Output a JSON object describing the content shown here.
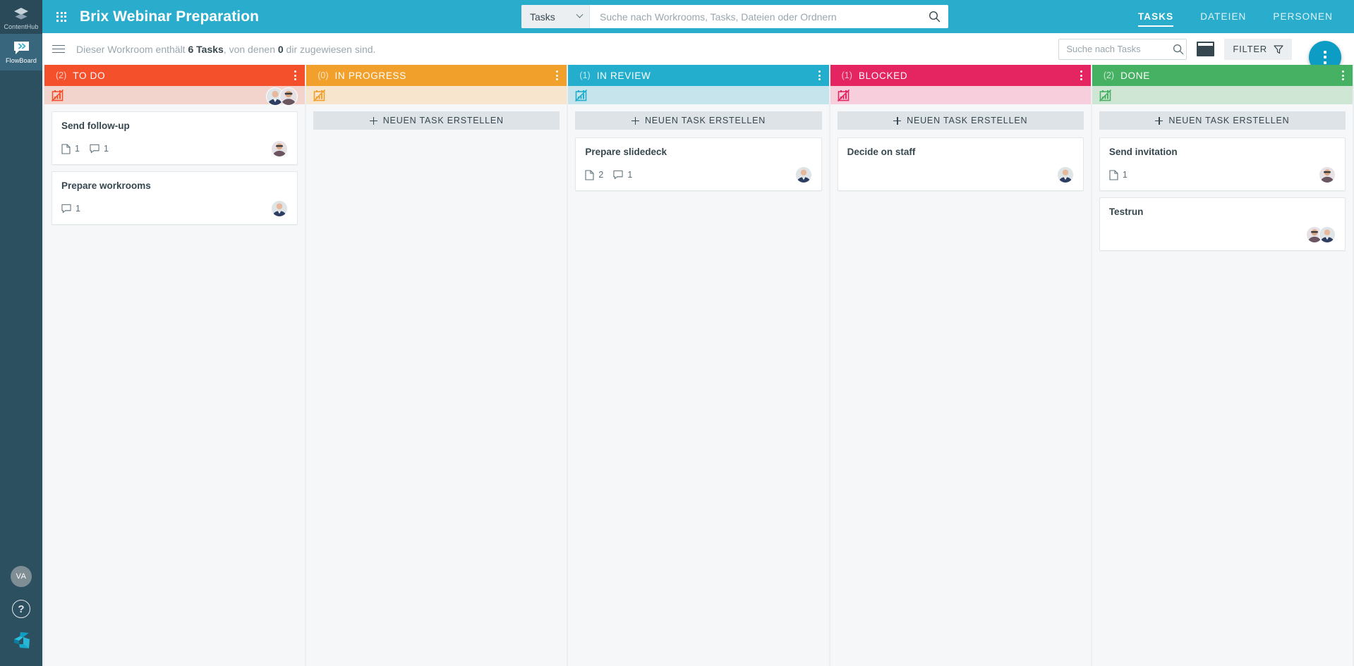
{
  "rail": {
    "items": [
      {
        "label": "ContentHub",
        "icon": "layers-icon",
        "active": false
      },
      {
        "label": "FlowBoard",
        "icon": "flowboard-icon",
        "active": true
      }
    ],
    "user_initials": "VA",
    "help_label": "?",
    "logo_name": "censhare-logo"
  },
  "topbar": {
    "app_title": "Brix Webinar Preparation",
    "grid_icon": "app-grid-icon",
    "search": {
      "scope_value": "Tasks",
      "placeholder": "Suche nach Workrooms, Tasks, Dateien oder Ordnern",
      "value": "",
      "search_icon": "search-icon",
      "chevron_icon": "chevron-down-icon"
    },
    "tabs": [
      {
        "label": "TASKS",
        "active": true
      },
      {
        "label": "DATEIEN",
        "active": false
      },
      {
        "label": "PERSONEN",
        "active": false
      }
    ],
    "bg_color": "#2aadcd"
  },
  "subbar": {
    "menu_icon": "hamburger-icon",
    "summary_prefix": "Dieser Workroom enthält ",
    "summary_tasks": "6 Tasks",
    "summary_middle": ", von denen ",
    "summary_assigned": "0",
    "summary_suffix": " dir zugewiesen sind.",
    "task_search_placeholder": "Suche nach Tasks",
    "task_search_value": "",
    "view_icon": "board-view-icon",
    "filter_label": "FILTER",
    "filter_icon": "funnel-icon",
    "fab_icon": "more-vertical-icon",
    "fab_color": "#0c9cc4"
  },
  "board": {
    "new_task_label": "NEUEN TASK ERSTELLEN",
    "columns": [
      {
        "title": "TO DO",
        "count": "(2)",
        "color": "#f4502c",
        "sub_color": "#f3d4cd",
        "chart_icon": "chart-disabled-icon",
        "header_avatars": 2,
        "cards": [
          {
            "title": "Send follow-up",
            "files": "1",
            "comments": "1",
            "avatars": 1
          },
          {
            "title": "Prepare workrooms",
            "files": null,
            "comments": "1",
            "avatars": 1
          }
        ]
      },
      {
        "title": "IN PROGRESS",
        "count": "(0)",
        "color": "#f1a02c",
        "sub_color": "#f7e5cd",
        "chart_icon": "chart-disabled-icon",
        "header_avatars": 0,
        "cards": []
      },
      {
        "title": "IN REVIEW",
        "count": "(1)",
        "color": "#23aecd",
        "sub_color": "#c6e4ec",
        "chart_icon": "chart-disabled-icon",
        "header_avatars": 0,
        "cards": [
          {
            "title": "Prepare slidedeck",
            "files": "2",
            "comments": "1",
            "avatars": 1
          }
        ]
      },
      {
        "title": "BLOCKED",
        "count": "(1)",
        "color": "#e52562",
        "sub_color": "#f6cedc",
        "chart_icon": "chart-disabled-icon",
        "header_avatars": 0,
        "cards": [
          {
            "title": "Decide on staff",
            "files": null,
            "comments": null,
            "avatars": 1
          }
        ]
      },
      {
        "title": "DONE",
        "count": "(2)",
        "color": "#46b162",
        "sub_color": "#cfe6d4",
        "chart_icon": "chart-disabled-icon",
        "header_avatars": 0,
        "cards": [
          {
            "title": "Send invitation",
            "files": "1",
            "comments": null,
            "avatars": 1
          },
          {
            "title": "Testrun",
            "files": null,
            "comments": null,
            "avatars": 2
          }
        ]
      }
    ]
  }
}
